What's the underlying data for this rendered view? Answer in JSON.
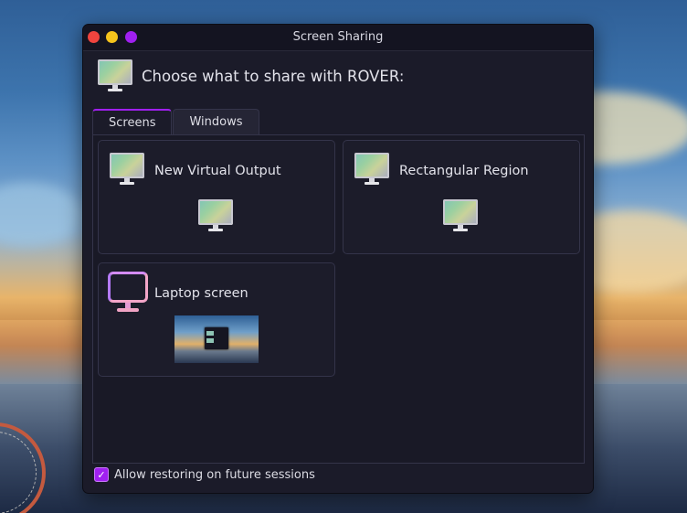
{
  "window": {
    "title": "Screen Sharing",
    "controls": {
      "close": "close",
      "minimize": "minimize",
      "maximize": "maximize"
    }
  },
  "header": {
    "prompt": "Choose what to share with ROVER:",
    "icon": "monitor-icon"
  },
  "tabs": [
    {
      "label": "Screens",
      "active": true
    },
    {
      "label": "Windows",
      "active": false
    }
  ],
  "sources": [
    {
      "label": "New Virtual Output",
      "icon": "monitor-icon",
      "preview": "monitor-icon"
    },
    {
      "label": "Rectangular Region",
      "icon": "monitor-icon",
      "preview": "monitor-icon"
    },
    {
      "label": "Laptop screen",
      "icon": "laptop-monitor-outline-icon",
      "preview": "screen-thumbnail"
    }
  ],
  "footer": {
    "checkbox_checked": true,
    "checkbox_label": "Allow restoring on future sessions"
  },
  "colors": {
    "accent": "#a020f0",
    "window_bg": "#1b1b29",
    "close": "#f0443e",
    "minimize": "#f5c31c",
    "maximize": "#a020f0"
  }
}
